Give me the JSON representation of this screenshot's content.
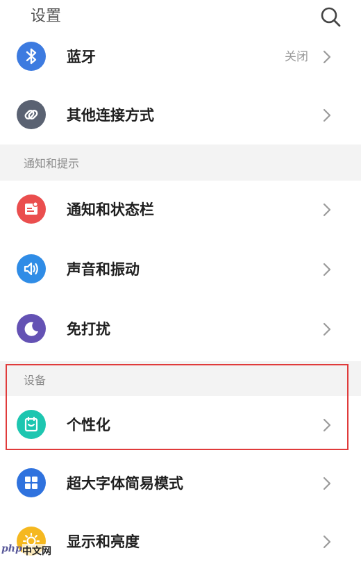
{
  "header": {
    "title": "设置"
  },
  "rows": [
    {
      "label": "蓝牙",
      "value": "关闭",
      "icon": "bluetooth-icon",
      "color": "#3d7be0"
    },
    {
      "label": "其他连接方式",
      "value": "",
      "icon": "link-icon",
      "color": "#5a6272"
    },
    {
      "label": "通知和状态栏",
      "value": "",
      "icon": "notification-icon",
      "color": "#ea4e4e"
    },
    {
      "label": "声音和振动",
      "value": "",
      "icon": "sound-icon",
      "color": "#2f8ce6"
    },
    {
      "label": "免打扰",
      "value": "",
      "icon": "moon-icon",
      "color": "#6452b4"
    },
    {
      "label": "个性化",
      "value": "",
      "icon": "personalization-icon",
      "color": "#1dc6b0"
    },
    {
      "label": "超大字体简易模式",
      "value": "",
      "icon": "grid-icon",
      "color": "#2f72de"
    },
    {
      "label": "显示和亮度",
      "value": "",
      "icon": "sun-icon",
      "color": "#f5b820"
    }
  ],
  "sections": {
    "notifications": "通知和提示",
    "device": "设备"
  },
  "highlight_color": "#e03b3b",
  "watermark": {
    "logo": "php",
    "site": "中文网"
  }
}
